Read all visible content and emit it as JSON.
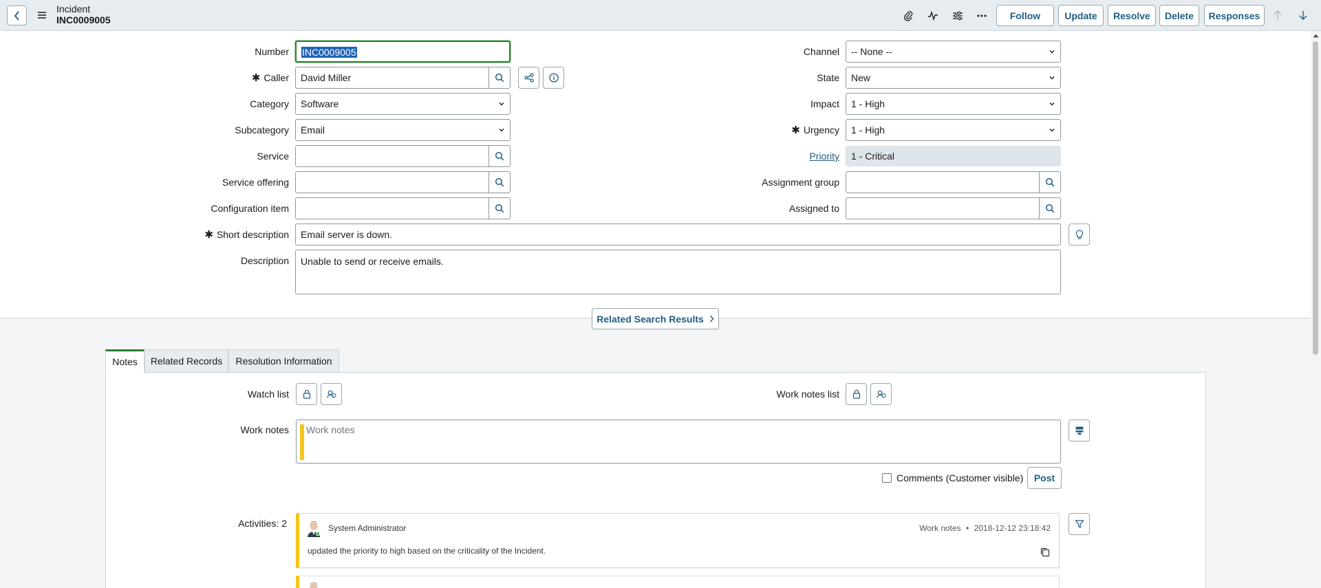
{
  "header": {
    "record_type": "Incident",
    "record_number": "INC0009005",
    "buttons": {
      "follow": "Follow",
      "update": "Update",
      "resolve": "Resolve",
      "delete": "Delete",
      "responses": "Responses"
    },
    "icons": [
      "attachment-icon",
      "activity-icon",
      "settings-icon",
      "more-icon"
    ]
  },
  "form": {
    "number": {
      "label": "Number",
      "value": "INC0009005"
    },
    "caller": {
      "label": "Caller",
      "value": "David Miller",
      "required": true
    },
    "category": {
      "label": "Category",
      "value": "Software"
    },
    "subcategory": {
      "label": "Subcategory",
      "value": "Email"
    },
    "service": {
      "label": "Service",
      "value": ""
    },
    "service_offering": {
      "label": "Service offering",
      "value": ""
    },
    "configuration_item": {
      "label": "Configuration item",
      "value": ""
    },
    "short_description": {
      "label": "Short description",
      "value": "Email server is down.",
      "required": true
    },
    "description": {
      "label": "Description",
      "value": "Unable to send or receive emails."
    },
    "channel": {
      "label": "Channel",
      "value": "-- None --"
    },
    "state": {
      "label": "State",
      "value": "New"
    },
    "impact": {
      "label": "Impact",
      "value": "1 - High"
    },
    "urgency": {
      "label": "Urgency",
      "value": "1 - High",
      "required": true
    },
    "priority": {
      "label": "Priority",
      "value": "1 - Critical"
    },
    "assignment_group": {
      "label": "Assignment group",
      "value": ""
    },
    "assigned_to": {
      "label": "Assigned to",
      "value": ""
    }
  },
  "related_search": {
    "label": "Related Search Results"
  },
  "tabs": [
    {
      "label": "Notes",
      "active": true
    },
    {
      "label": "Related Records",
      "active": false
    },
    {
      "label": "Resolution Information",
      "active": false
    }
  ],
  "notes": {
    "watch_list_label": "Watch list",
    "work_notes_list_label": "Work notes list",
    "work_notes_label": "Work notes",
    "work_notes_placeholder": "Work notes",
    "comments_checkbox_label": "Comments (Customer visible)",
    "post_label": "Post",
    "activities_label": "Activities: 2"
  },
  "activities": [
    {
      "author": "System Administrator",
      "type": "Work notes",
      "separator": "•",
      "timestamp": "2018-12-12 23:18:42",
      "text": "updated the priority to high based on the criticality of the Incident."
    }
  ],
  "colors": {
    "accent": "#1f5e83",
    "active_tab": "#2e7d32",
    "work_notes_bar": "#f5c518",
    "header_bg": "#e6ecef"
  }
}
